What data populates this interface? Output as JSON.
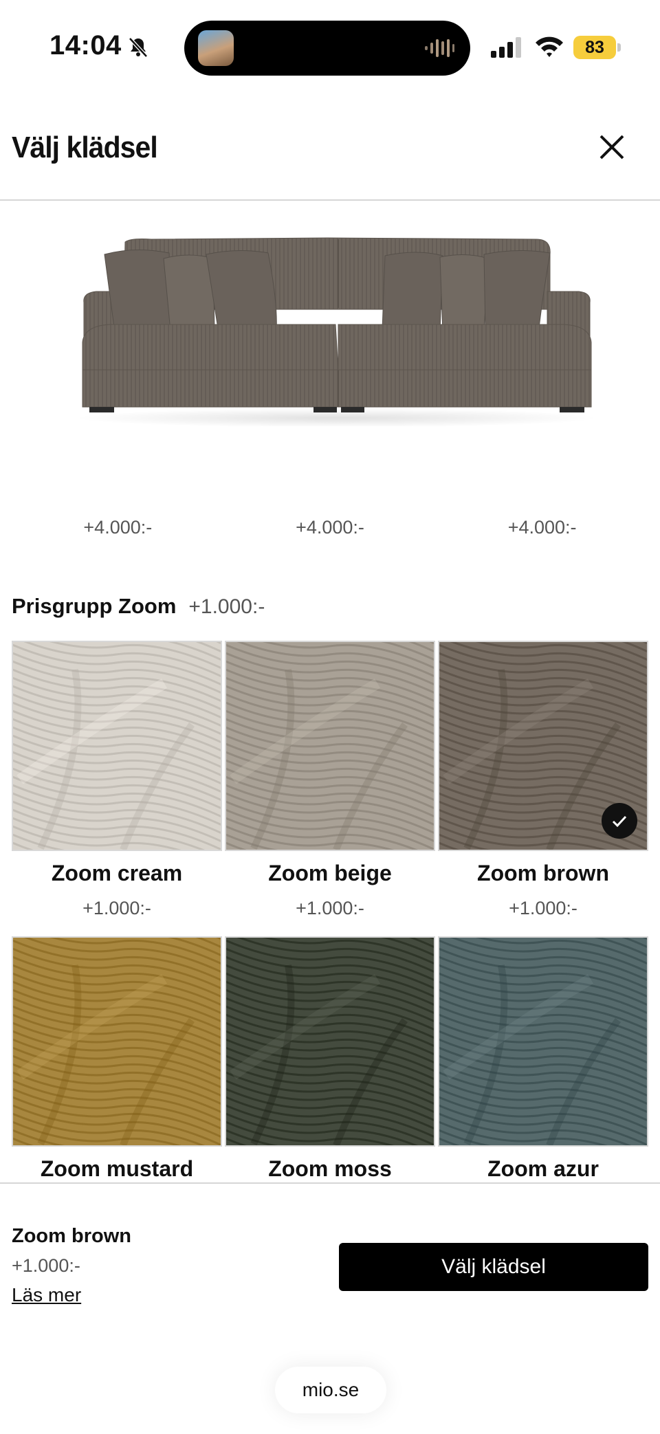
{
  "status_bar": {
    "time": "14:04",
    "battery": "83"
  },
  "header": {
    "title": "Välj klädsel"
  },
  "top_row_prices": [
    "+4.000:-",
    "+4.000:-",
    "+4.000:-"
  ],
  "group": {
    "name": "Prisgrupp Zoom",
    "price": "+1.000:-"
  },
  "tiles": [
    {
      "name": "Zoom cream",
      "price": "+1.000:-",
      "color": "#d9d4cc"
    },
    {
      "name": "Zoom beige",
      "price": "+1.000:-",
      "color": "#a9a196"
    },
    {
      "name": "Zoom brown",
      "price": "+1.000:-",
      "color": "#766c62",
      "selected": true
    },
    {
      "name": "Zoom mustard",
      "color": "#a8873f"
    },
    {
      "name": "Zoom moss",
      "color": "#444b3e"
    },
    {
      "name": "Zoom azur",
      "color": "#566a6c"
    }
  ],
  "selection": {
    "name": "Zoom brown",
    "price": "+1.000:-",
    "read_more": "Läs mer",
    "button": "Välj klädsel"
  },
  "browser": {
    "url": "mio.se"
  },
  "colors": {
    "accent": "#000000",
    "battery": "#f6cd3c",
    "sofa": "#6f675f"
  }
}
